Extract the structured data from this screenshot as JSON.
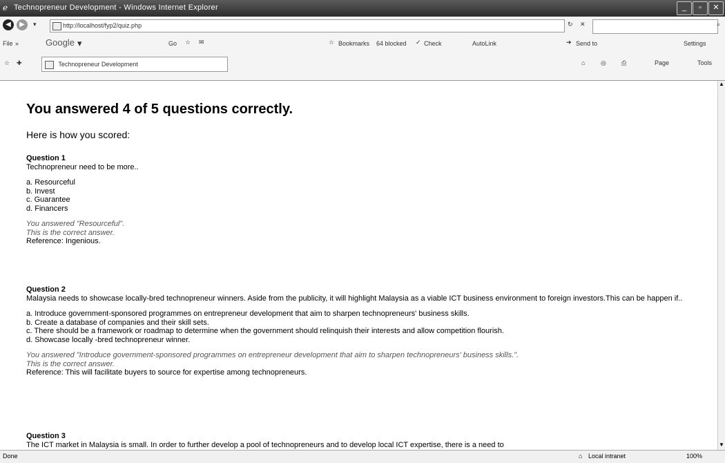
{
  "window": {
    "title": "Technopreneur Development - Windows Internet Explorer"
  },
  "address": {
    "url": "http://localhost/fyp2/quiz.php"
  },
  "search_box": {
    "placeholder": ""
  },
  "toolbar": {
    "file": "File",
    "google": "Google",
    "go": "Go",
    "bookmarks": "Bookmarks",
    "blocked": "64 blocked",
    "check": "Check",
    "autolink": "AutoLink",
    "send_to": "Send to",
    "settings": "Settings"
  },
  "tab": {
    "label": "Technopreneur Development"
  },
  "command_bar": {
    "page": "Page",
    "tools": "Tools"
  },
  "result": {
    "heading": "You answered 4 of 5 questions correctly.",
    "intro": "Here is how you scored:"
  },
  "questions": [
    {
      "title": "Question 1",
      "text": "Technopreneur need to be more..",
      "options": [
        "a. Resourceful",
        "b. Invest",
        "c. Guarantee",
        "d. Financers"
      ],
      "answered": "You answered \"Resourceful\".",
      "correct": "This is the correct answer.",
      "reference": "Reference: Ingenious."
    },
    {
      "title": "Question 2",
      "text": "Malaysia needs to showcase locally-bred technopreneur winners. Aside from the publicity, it will highlight Malaysia as a viable ICT business environment to foreign investors.This can be happen if..",
      "options": [
        "a. Introduce government-sponsored programmes on entrepreneur development that aim to sharpen technopreneurs' business skills.",
        "b. Create a database of companies and their skill sets.",
        "c. There should be a framework or roadmap to determine when the government should relinquish their interests and allow competition flourish.",
        "d. Showcase locally -bred technopreneur winner."
      ],
      "answered": "You answered \"Introduce government-sponsored programmes on entrepreneur development that aim to sharpen technopreneurs' business skills.\".",
      "correct": "This is the correct answer.",
      "reference": "Reference: This will facilitate buyers to source for expertise among technopreneurs."
    },
    {
      "title": "Question 3",
      "text": "The ICT market in Malaysia is small. In order to further develop a pool of technopreneurs and to develop local ICT expertise, there is a need to"
    }
  ],
  "status": {
    "left": "Done",
    "zone": "Local intranet",
    "zoom": "100%"
  }
}
